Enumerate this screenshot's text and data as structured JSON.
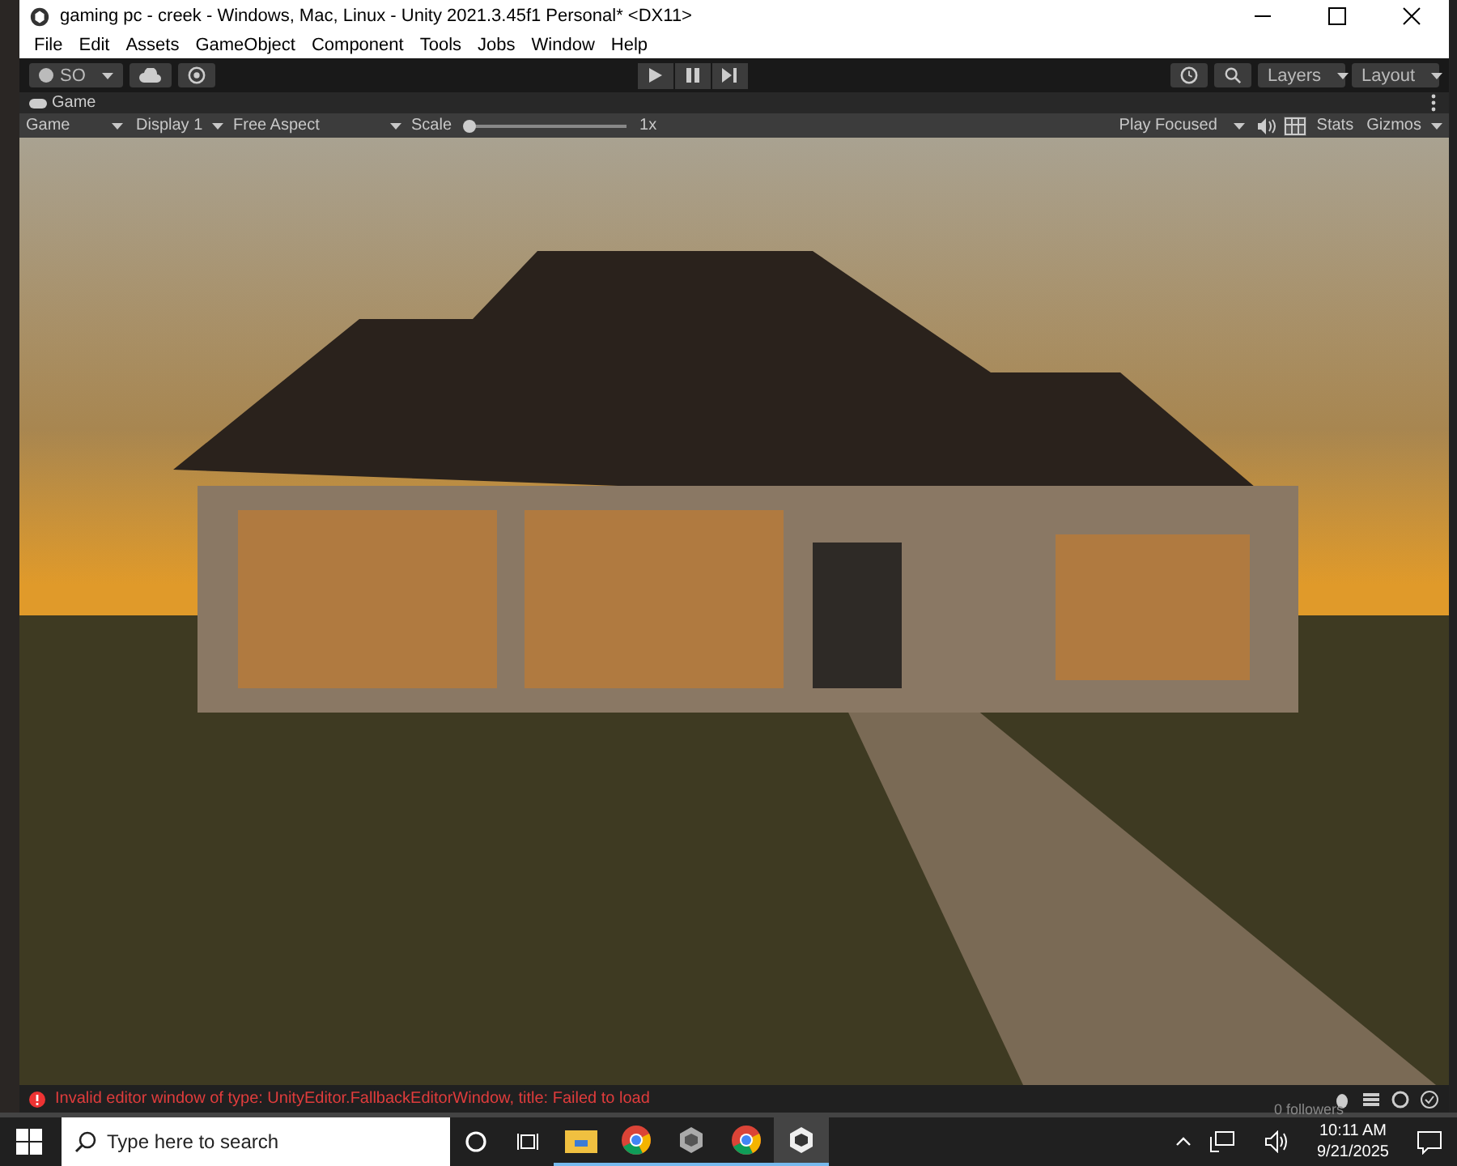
{
  "window": {
    "title": "gaming pc - creek - Windows, Mac, Linux - Unity 2021.3.45f1 Personal* <DX11>"
  },
  "menu": [
    "File",
    "Edit",
    "Assets",
    "GameObject",
    "Component",
    "Tools",
    "Jobs",
    "Window",
    "Help"
  ],
  "toolbar": {
    "account": "SO",
    "layers": "Layers",
    "layout": "Layout"
  },
  "game_tab": {
    "label": "Game"
  },
  "game_toolbar": {
    "view": "Game",
    "display": "Display 1",
    "aspect": "Free Aspect",
    "scale": {
      "label": "Scale",
      "level": 0,
      "value": "1x"
    },
    "play_mode": "Play Focused",
    "stats": "Stats",
    "gizmos": "Gizmos"
  },
  "console": {
    "message": "Invalid editor window of type: UnityEditor.FallbackEditorWindow, title: Failed to load"
  },
  "desktop": {
    "text": "0 followers"
  },
  "taskbar": {
    "search": {
      "placeholder": "Type here to search"
    },
    "apps": [
      {
        "kind": "explorer",
        "selected": false
      },
      {
        "kind": "chrome",
        "selected": false
      },
      {
        "kind": "hub",
        "selected": false
      },
      {
        "kind": "chrome",
        "selected": false
      },
      {
        "kind": "unity",
        "selected": true
      }
    ],
    "time": "10:11 AM",
    "date": "9/21/2025"
  }
}
